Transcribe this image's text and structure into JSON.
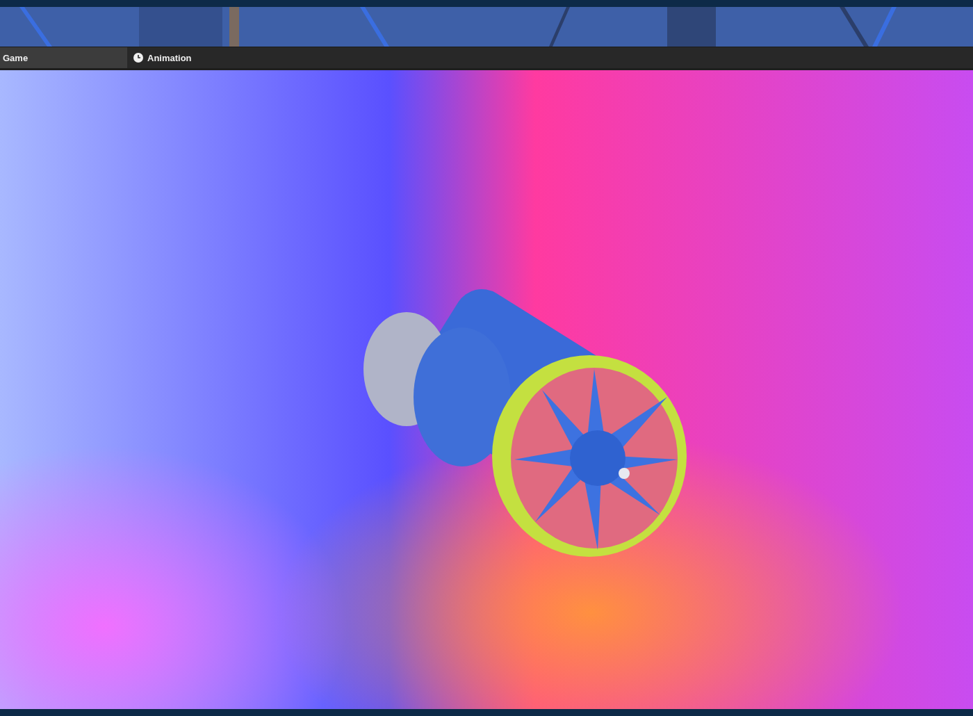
{
  "tabs": [
    {
      "label": "Game",
      "selected": true,
      "kind": "plain"
    },
    {
      "label": "Animation",
      "selected": false,
      "kind": "clock"
    }
  ]
}
